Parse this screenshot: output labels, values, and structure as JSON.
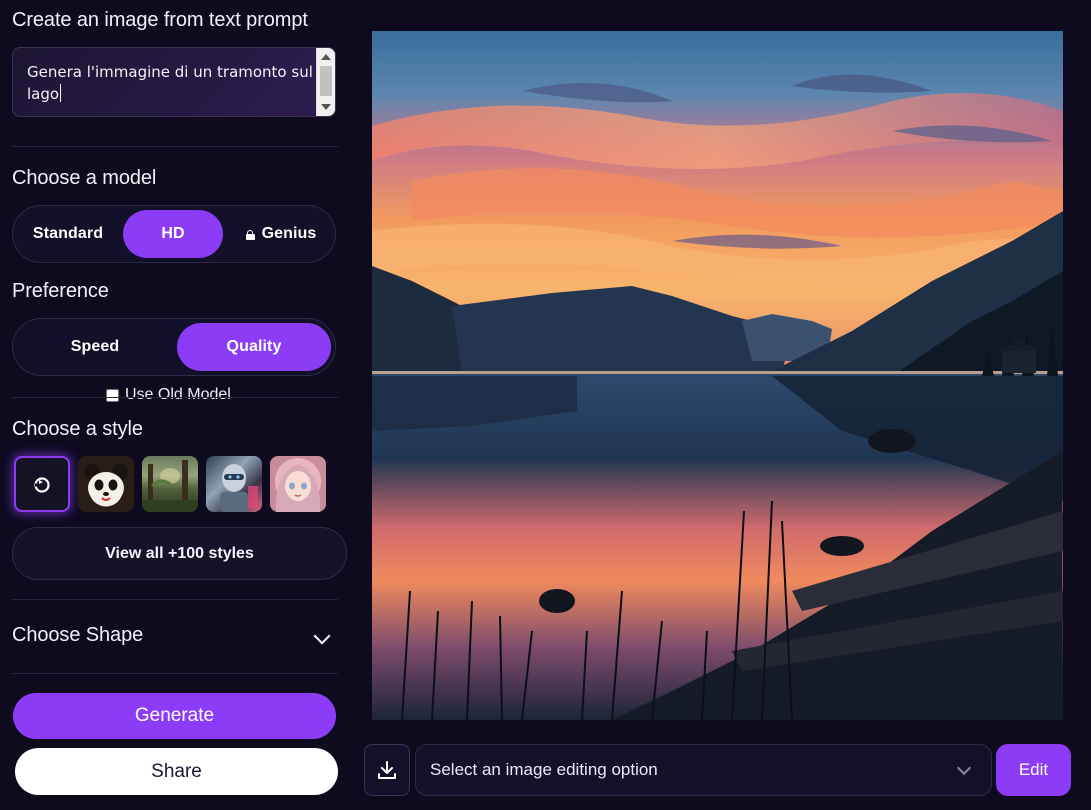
{
  "prompt_section": {
    "title": "Create an image from text prompt",
    "text": "Genera l'immagine di un tramonto sul lago"
  },
  "model_section": {
    "title": "Choose a model",
    "options": [
      "Standard",
      "HD",
      "Genius"
    ],
    "selected": "HD",
    "locked": [
      "Genius"
    ]
  },
  "preference_section": {
    "title": "Preference",
    "options": [
      "Speed",
      "Quality"
    ],
    "selected": "Quality",
    "use_old_model_label": "Use Old Model",
    "use_old_model_checked": false
  },
  "style_section": {
    "title": "Choose a style",
    "styles": [
      "no-style-icon",
      "panda",
      "forest",
      "robot",
      "anime-girl"
    ],
    "selected_index": 0,
    "view_all_label": "View all +100 styles"
  },
  "shape_section": {
    "title": "Choose Shape"
  },
  "actions": {
    "generate_label": "Generate",
    "share_label": "Share"
  },
  "editor": {
    "select_placeholder": "Select an image editing option",
    "edit_label": "Edit"
  },
  "colors": {
    "accent": "#8c3cf7",
    "background": "#0e0b1f"
  }
}
